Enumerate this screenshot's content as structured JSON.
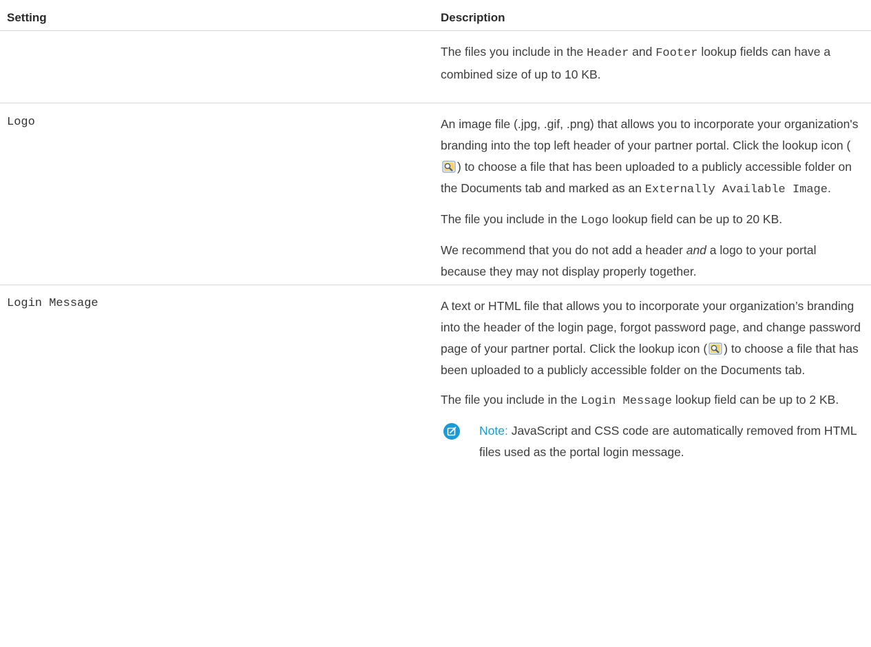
{
  "headers": {
    "setting": "Setting",
    "description": "Description"
  },
  "row1": {
    "p1_before": "The files you include in the ",
    "p1_code1": "Header",
    "p1_mid": " and ",
    "p1_code2": "Footer",
    "p1_after": " lookup fields can have a combined size of up to 10 KB."
  },
  "logo": {
    "setting": "Logo",
    "p1_before": "An image file (.jpg, .gif, .png) that allows you to incorporate your organization's branding into the top left header of your partner portal. Click the lookup icon (",
    "p1_after": ") to choose a file that has been uploaded to a publicly accessible folder on the Documents tab and marked as an ",
    "p1_code": "Externally Available Image",
    "p1_end": ".",
    "p2_before": "The file you include in the ",
    "p2_code": "Logo",
    "p2_after": " lookup field can be up to 20 KB.",
    "p3_before": "We recommend that you do not add a header ",
    "p3_em": "and",
    "p3_after": " a logo to your portal because they may not display properly together."
  },
  "login": {
    "setting": "Login Message",
    "p1_before": "A text or HTML file that allows you to incorporate your organization’s branding into the header of the login page, forgot password page, and change password page of your partner portal. Click the lookup icon (",
    "p1_after": ") to choose a file that has been uploaded to a publicly accessible folder on the Documents tab.",
    "p2_before": "The file you include in the ",
    "p2_code": "Login Message",
    "p2_after": " lookup field can be up to 2 KB.",
    "note_label": "Note:",
    "note_text": "JavaScript and CSS code are automatically removed from HTML files used as the portal login message."
  },
  "icons": {
    "lookup": "lookup-icon",
    "note": "note-edit-icon"
  },
  "colors": {
    "note_accent": "#1a9ad6",
    "divider": "#d6d6d6"
  }
}
